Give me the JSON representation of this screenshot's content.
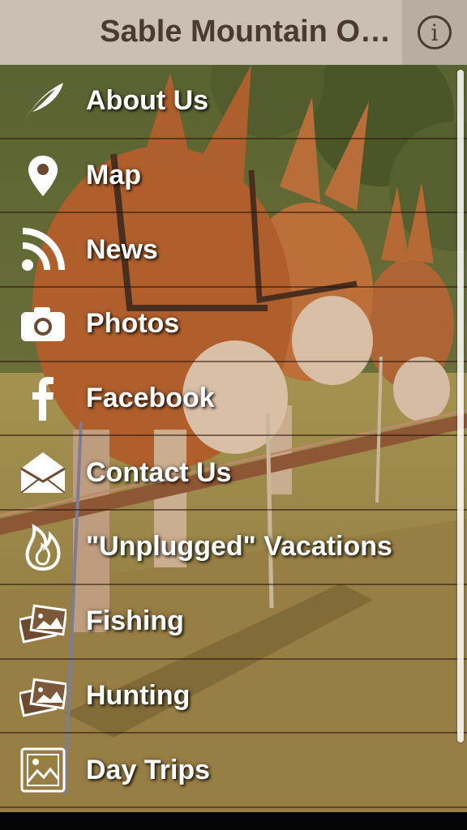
{
  "header": {
    "title": "Sable Mountain O…",
    "info_icon": "info-icon"
  },
  "menu": {
    "items": [
      {
        "label": "About Us",
        "icon": "feather-icon"
      },
      {
        "label": "Map",
        "icon": "map-pin-icon"
      },
      {
        "label": "News",
        "icon": "rss-icon"
      },
      {
        "label": "Photos",
        "icon": "camera-icon"
      },
      {
        "label": "Facebook",
        "icon": "facebook-icon"
      },
      {
        "label": "Contact Us",
        "icon": "envelope-icon"
      },
      {
        "label": "\"Unplugged\" Vacations",
        "icon": "fire-icon"
      },
      {
        "label": "Fishing",
        "icon": "photos-icon"
      },
      {
        "label": "Hunting",
        "icon": "photos-icon"
      },
      {
        "label": "Day Trips",
        "icon": "picture-icon"
      }
    ]
  },
  "colors": {
    "header_bg": "#c9c0b3",
    "header_text": "#4a3a30",
    "menu_text": "#ffffff"
  }
}
